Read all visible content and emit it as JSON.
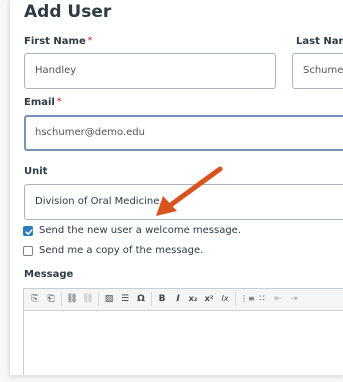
{
  "page_title": "Add User",
  "first_name": {
    "label": "First Name",
    "required": "*",
    "value": "Handley"
  },
  "last_name": {
    "label": "Last Name",
    "value": "Schumer"
  },
  "email": {
    "label": "Email",
    "required": "*",
    "value": "hschumer@demo.edu"
  },
  "unit": {
    "label": "Unit",
    "value": "Division of Oral Medicine"
  },
  "options": {
    "send_welcome": {
      "label": "Send the new user a welcome message.",
      "checked": true
    },
    "send_copy": {
      "label": "Send me a copy of the message.",
      "checked": false
    }
  },
  "message": {
    "label": "Message",
    "toolbar": [
      {
        "name": "paste-icon",
        "glyph": "⎘"
      },
      {
        "name": "paste-text-icon",
        "glyph": "⎗"
      },
      {
        "name": "link-icon",
        "glyph": "⛓"
      },
      {
        "name": "unlink-icon",
        "glyph": "⛓"
      },
      {
        "name": "image-icon",
        "glyph": "▨"
      },
      {
        "name": "horizontal-line-icon",
        "glyph": "☰"
      },
      {
        "name": "special-character-icon",
        "glyph": "Ω"
      },
      {
        "name": "bold-icon",
        "glyph": "B"
      },
      {
        "name": "italic-icon",
        "glyph": "I"
      },
      {
        "name": "subscript-icon",
        "glyph": "x₂"
      },
      {
        "name": "superscript-icon",
        "glyph": "x²"
      },
      {
        "name": "remove-format-icon",
        "glyph": "Ix"
      },
      {
        "name": "numbered-list-icon",
        "glyph": "⋮≡"
      },
      {
        "name": "bulleted-list-icon",
        "glyph": "∷"
      },
      {
        "name": "outdent-icon",
        "glyph": "⇤"
      },
      {
        "name": "indent-icon",
        "glyph": "⇥"
      }
    ]
  },
  "annotation_color": "#d9531e",
  "accent_color": "#2b7abc"
}
